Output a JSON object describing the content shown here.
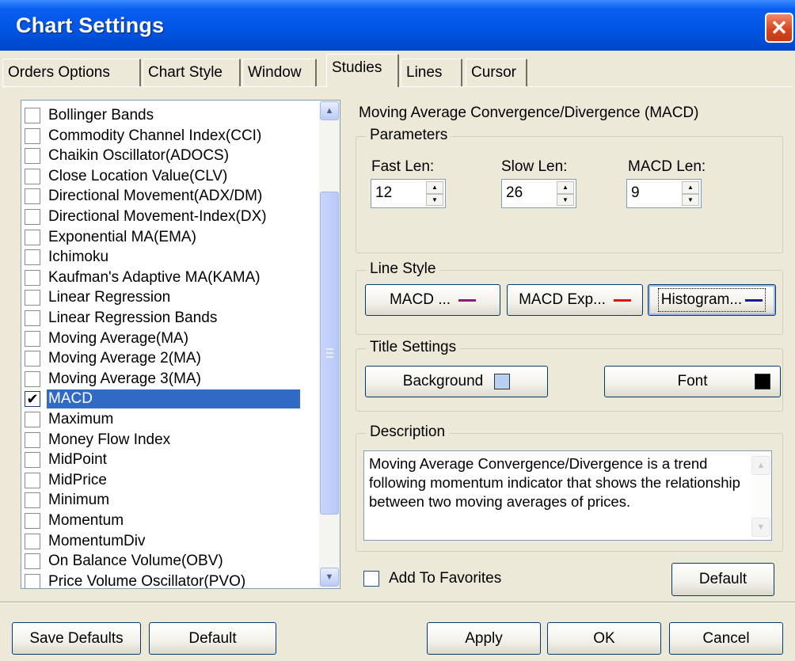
{
  "window": {
    "title": "Chart Settings"
  },
  "tabs": [
    "Orders Options",
    "Chart Style",
    "Window",
    "Studies",
    "Lines",
    "Cursor"
  ],
  "active_tab": "Studies",
  "studies": [
    {
      "label": "Bollinger Bands",
      "checked": false
    },
    {
      "label": "Commodity Channel Index(CCI)",
      "checked": false
    },
    {
      "label": "Chaikin Oscillator(ADOCS)",
      "checked": false
    },
    {
      "label": "Close Location Value(CLV)",
      "checked": false
    },
    {
      "label": "Directional Movement(ADX/DM)",
      "checked": false
    },
    {
      "label": "Directional Movement-Index(DX)",
      "checked": false
    },
    {
      "label": "Exponential MA(EMA)",
      "checked": false
    },
    {
      "label": "Ichimoku",
      "checked": false
    },
    {
      "label": "Kaufman's Adaptive MA(KAMA)",
      "checked": false
    },
    {
      "label": "Linear Regression",
      "checked": false
    },
    {
      "label": "Linear Regression Bands",
      "checked": false
    },
    {
      "label": "Moving Average(MA)",
      "checked": false
    },
    {
      "label": "Moving Average 2(MA)",
      "checked": false
    },
    {
      "label": "Moving Average 3(MA)",
      "checked": false
    },
    {
      "label": "MACD",
      "checked": true,
      "selected": true
    },
    {
      "label": "Maximum",
      "checked": false
    },
    {
      "label": "Money Flow Index",
      "checked": false
    },
    {
      "label": "MidPoint",
      "checked": false
    },
    {
      "label": "MidPrice",
      "checked": false
    },
    {
      "label": "Minimum",
      "checked": false
    },
    {
      "label": "Momentum",
      "checked": false
    },
    {
      "label": "MomentumDiv",
      "checked": false
    },
    {
      "label": "On Balance Volume(OBV)",
      "checked": false
    },
    {
      "label": "Price Volume Oscillator(PVO)",
      "checked": false
    }
  ],
  "study_title": "Moving Average Convergence/Divergence (MACD)",
  "parameters": {
    "legend": "Parameters",
    "fast_label": "Fast Len:",
    "fast_value": "12",
    "slow_label": "Slow Len:",
    "slow_value": "26",
    "macd_label": "MACD Len:",
    "macd_value": "9"
  },
  "line_style": {
    "legend": "Line Style",
    "macd_label": "MACD ...",
    "macd_color": "#8b1a7a",
    "exp_label": "MACD Exp...",
    "exp_color": "#e01010",
    "hist_label": "Histogram...",
    "hist_color": "#1a1a9c"
  },
  "title_settings": {
    "legend": "Title Settings",
    "background_label": "Background",
    "background_color": "#b8d0f0",
    "font_label": "Font",
    "font_color": "#000000"
  },
  "description": {
    "legend": "Description",
    "text": "Moving Average Convergence/Divergence is a trend following momentum indicator that shows the relationship between two moving averages of prices."
  },
  "add_to_favorites": {
    "label": "Add To Favorites",
    "checked": false
  },
  "buttons": {
    "default_right": "Default",
    "save_defaults": "Save Defaults",
    "default_bottom": "Default",
    "apply": "Apply",
    "ok": "OK",
    "cancel": "Cancel"
  }
}
